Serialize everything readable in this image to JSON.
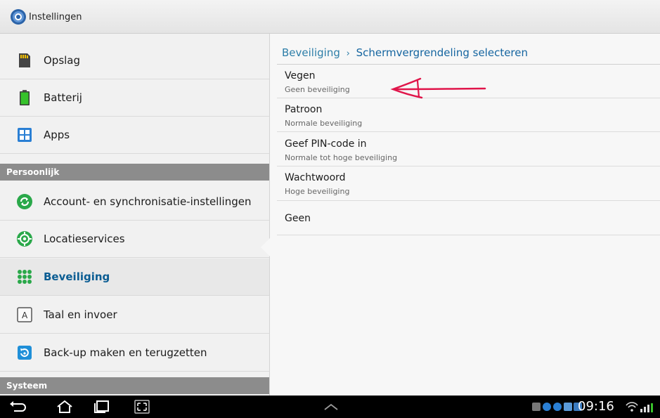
{
  "app": {
    "title": "Instellingen",
    "icon": "settings-gear-icon"
  },
  "sidebar": {
    "items_top": [
      {
        "label": "Opslag",
        "icon": "storage-sd-icon"
      },
      {
        "label": "Batterij",
        "icon": "battery-icon"
      },
      {
        "label": "Apps",
        "icon": "apps-grid-icon"
      }
    ],
    "section_personal": "Persoonlijk",
    "items_personal": [
      {
        "label": "Account- en synchronisatie-instellingen",
        "icon": "sync-icon"
      },
      {
        "label": "Locatieservices",
        "icon": "location-target-icon"
      },
      {
        "label": "Beveiliging",
        "icon": "security-dots-icon",
        "active": true
      },
      {
        "label": "Taal en invoer",
        "icon": "keyboard-a-icon"
      },
      {
        "label": "Back-up maken en terugzetten",
        "icon": "backup-restore-icon"
      }
    ],
    "section_system": "Systeem"
  },
  "breadcrumb": {
    "parent": "Beveiliging",
    "separator": "›",
    "current": "Schermvergrendeling selecteren"
  },
  "options": [
    {
      "title": "Vegen",
      "subtitle": "Geen beveiliging"
    },
    {
      "title": "Patroon",
      "subtitle": "Normale beveiliging"
    },
    {
      "title": "Geef PIN-code in",
      "subtitle": "Normale tot hoge beveiliging"
    },
    {
      "title": "Wachtwoord",
      "subtitle": "Hoge beveiliging"
    },
    {
      "title": "Geen",
      "subtitle": ""
    }
  ],
  "navbar": {
    "time": "09:16"
  },
  "colors": {
    "accent": "#0b5d93",
    "crumb": "#2d7ea8",
    "annotation": "#e0154a",
    "section_header": "#8c8c8c"
  }
}
